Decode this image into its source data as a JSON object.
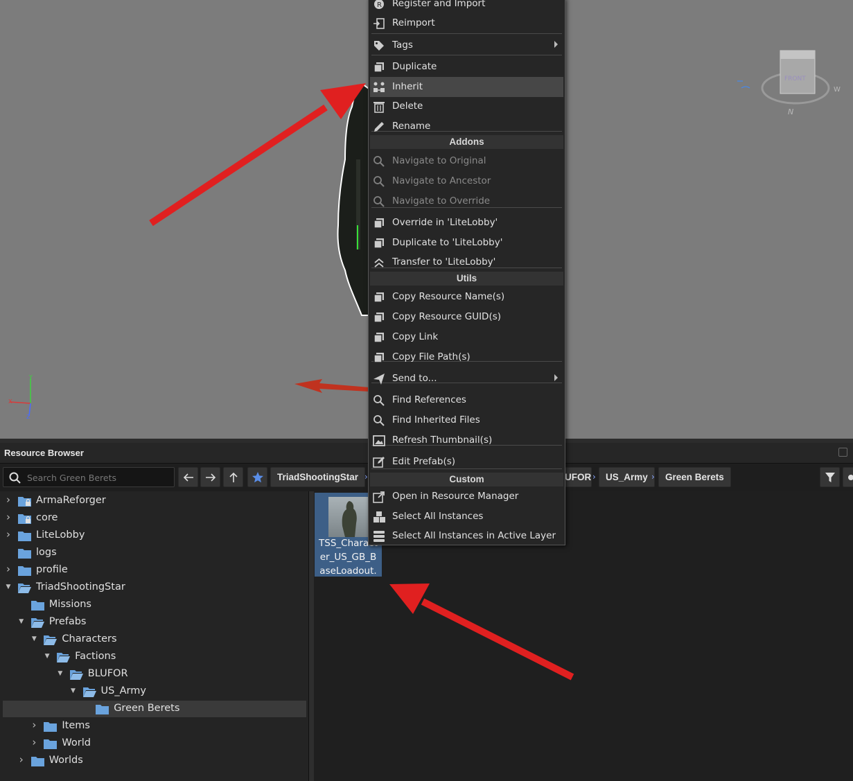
{
  "menu": {
    "items": [
      {
        "label": "Register and Import",
        "icon": "register-icon"
      },
      {
        "label": "Reimport",
        "icon": "reimport-icon"
      },
      {
        "label": "Tags",
        "icon": "tag-icon",
        "submenu": true
      },
      {
        "label": "Duplicate",
        "icon": "duplicate-icon"
      },
      {
        "label": "Inherit",
        "icon": "inherit-icon",
        "hover": true
      },
      {
        "label": "Delete",
        "icon": "trash-icon"
      },
      {
        "label": "Rename",
        "icon": "pencil-icon"
      },
      {
        "label": "Navigate to Original",
        "icon": "search-icon",
        "disabled": true
      },
      {
        "label": "Navigate to Ancestor",
        "icon": "search-icon",
        "disabled": true
      },
      {
        "label": "Navigate to Override",
        "icon": "search-icon",
        "disabled": true
      },
      {
        "label": "Override in 'LiteLobby'",
        "icon": "duplicate-icon"
      },
      {
        "label": "Duplicate to 'LiteLobby'",
        "icon": "duplicate-icon"
      },
      {
        "label": "Transfer to 'LiteLobby'",
        "icon": "double-chevron-up-icon"
      },
      {
        "label": "Copy Resource Name(s)",
        "icon": "duplicate-icon"
      },
      {
        "label": "Copy Resource GUID(s)",
        "icon": "duplicate-icon"
      },
      {
        "label": "Copy Link",
        "icon": "duplicate-icon"
      },
      {
        "label": "Copy File Path(s)",
        "icon": "duplicate-icon"
      },
      {
        "label": "Send to...",
        "icon": "send-icon",
        "submenu": true
      },
      {
        "label": "Find References",
        "icon": "search-icon"
      },
      {
        "label": "Find Inherited Files",
        "icon": "search-icon"
      },
      {
        "label": "Refresh Thumbnail(s)",
        "icon": "image-icon"
      },
      {
        "label": "Edit Prefab(s)",
        "icon": "edit-icon"
      },
      {
        "label": "Open in Resource Manager",
        "icon": "external-link-icon"
      },
      {
        "label": "Select All Instances",
        "icon": "cubes-icon"
      },
      {
        "label": "Select All Instances in Active Layer",
        "icon": "layers-icon"
      }
    ],
    "headers": {
      "addons": "Addons",
      "utils": "Utils",
      "custom": "Custom"
    }
  },
  "resource_browser": {
    "title": "Resource Browser",
    "search_placeholder": "Search Green Berets",
    "breadcrumbs": [
      "TriadShootingStar",
      "UFOR",
      "US_Army",
      "Green Berets"
    ],
    "tree": [
      {
        "label": "ArmaReforger",
        "locked": true
      },
      {
        "label": "core",
        "locked": true
      },
      {
        "label": "LiteLobby"
      },
      {
        "label": "logs"
      },
      {
        "label": "profile"
      },
      {
        "label": "TriadShootingStar"
      },
      {
        "label": "Missions"
      },
      {
        "label": "Prefabs"
      },
      {
        "label": "Characters"
      },
      {
        "label": "Factions"
      },
      {
        "label": "BLUFOR"
      },
      {
        "label": "US_Army"
      },
      {
        "label": "Green Berets"
      },
      {
        "label": "Items"
      },
      {
        "label": "World"
      },
      {
        "label": "Worlds"
      }
    ],
    "files": [
      {
        "name": "TSS_Character_US_GB_BaseLoadout."
      }
    ]
  },
  "viewport": {
    "gizmo": {
      "face_label": "FRONT",
      "compass_n": "N",
      "compass_w": "W"
    }
  },
  "colors": {
    "menu_bg": "#262626",
    "menu_hover": "#474747",
    "selection_blue": "#3d5f87",
    "folder_blue": "#5b9bd5",
    "annotation_red": "#e02020"
  }
}
